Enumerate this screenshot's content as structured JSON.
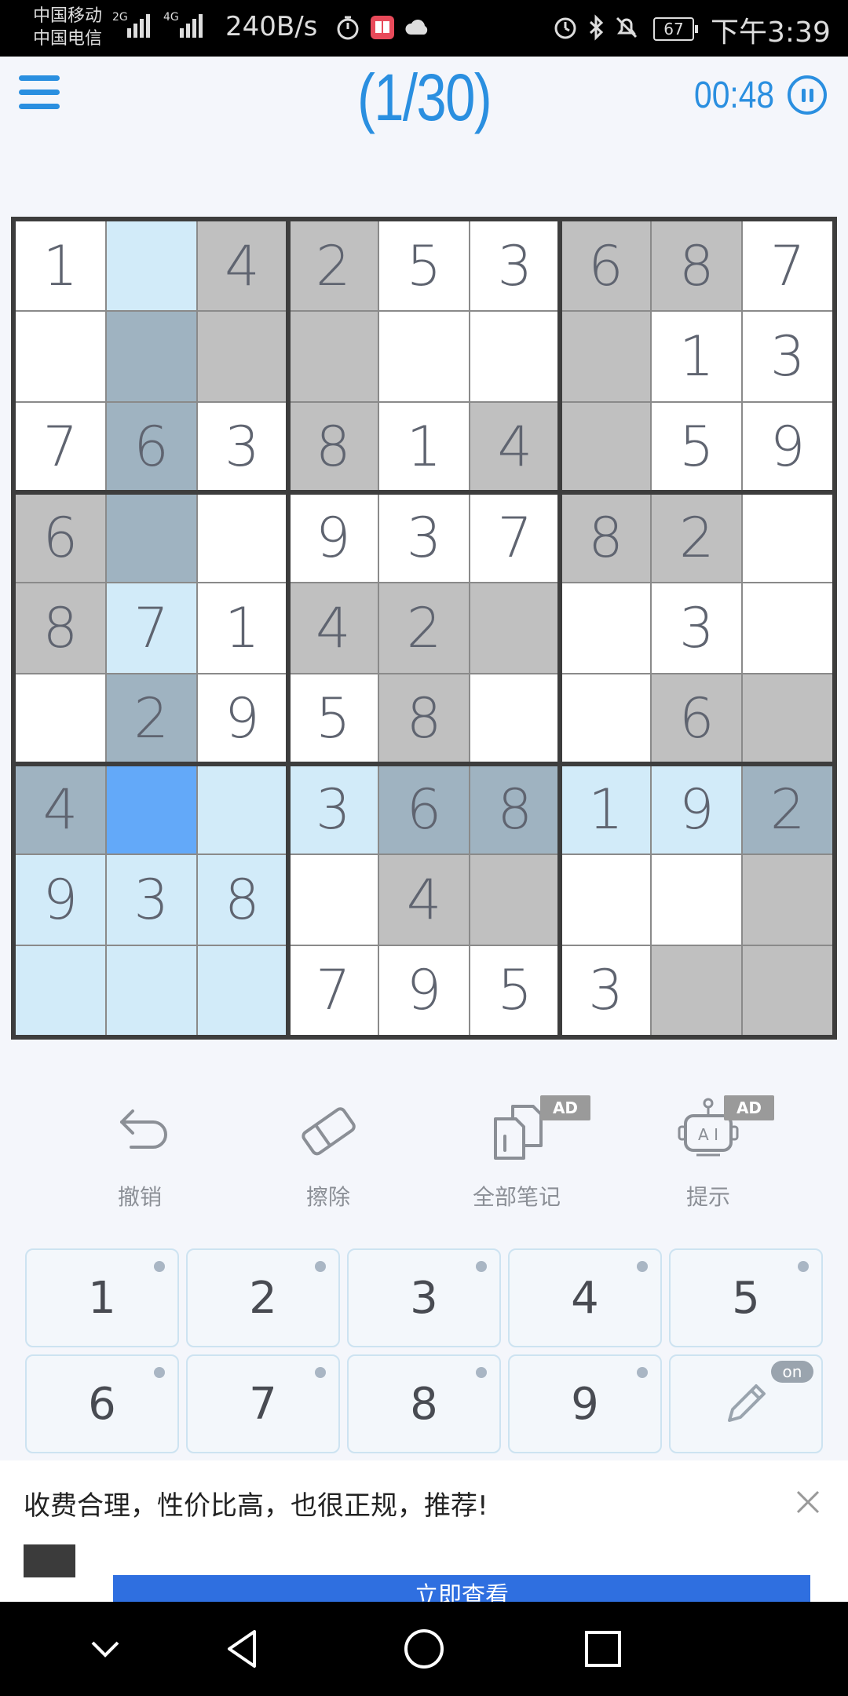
{
  "status_bar": {
    "carrier_1": "中国移动",
    "carrier_2": "中国电信",
    "net_1": "2G",
    "net_2": "4G",
    "speed": "240B/s",
    "battery": "67",
    "time": "下午3:39"
  },
  "header": {
    "level": "(1/30)",
    "timer": "00:48"
  },
  "board": {
    "rows": [
      [
        "1",
        "",
        "4",
        "2",
        "5",
        "3",
        "6",
        "8",
        "7"
      ],
      [
        "",
        "",
        "",
        "",
        "",
        "",
        "",
        "1",
        "3"
      ],
      [
        "7",
        "6",
        "3",
        "8",
        "1",
        "4",
        "",
        "5",
        "9"
      ],
      [
        "6",
        "",
        "",
        "9",
        "3",
        "7",
        "8",
        "2",
        ""
      ],
      [
        "8",
        "7",
        "1",
        "4",
        "2",
        "",
        "",
        "3",
        ""
      ],
      [
        "",
        "2",
        "9",
        "5",
        "8",
        "",
        "",
        "6",
        ""
      ],
      [
        "4",
        "",
        "",
        "3",
        "6",
        "8",
        "1",
        "9",
        "2"
      ],
      [
        "9",
        "3",
        "8",
        "",
        "4",
        "",
        "",
        "",
        ""
      ],
      [
        "",
        "",
        "",
        "7",
        "9",
        "5",
        "3",
        "",
        ""
      ]
    ],
    "shading": [
      [
        "w",
        "l",
        "g",
        "g",
        "w",
        "w",
        "g",
        "g",
        "w"
      ],
      [
        "w",
        "b",
        "g",
        "g",
        "w",
        "w",
        "g",
        "w",
        "w"
      ],
      [
        "w",
        "b",
        "w",
        "g",
        "w",
        "g",
        "g",
        "w",
        "w"
      ],
      [
        "g",
        "b",
        "w",
        "w",
        "w",
        "w",
        "g",
        "g",
        "w"
      ],
      [
        "g",
        "l",
        "w",
        "g",
        "g",
        "g",
        "w",
        "w",
        "w"
      ],
      [
        "w",
        "b",
        "w",
        "w",
        "g",
        "w",
        "w",
        "g",
        "g"
      ],
      [
        "b",
        "s",
        "l",
        "l",
        "b",
        "b",
        "l",
        "l",
        "b"
      ],
      [
        "l",
        "l",
        "l",
        "w",
        "g",
        "g",
        "w",
        "w",
        "g"
      ],
      [
        "l",
        "l",
        "l",
        "w",
        "w",
        "w",
        "w",
        "g",
        "g"
      ]
    ],
    "colors": {
      "white": "#ffffff",
      "gray": "#c0c0c0",
      "light_blue": "#d2ebf9",
      "blue_gray": "#9fb3c1",
      "selected": "#63a9f9"
    }
  },
  "tools": [
    {
      "label": "撤销",
      "icon": "undo-icon",
      "ad": ""
    },
    {
      "label": "擦除",
      "icon": "eraser-icon",
      "ad": ""
    },
    {
      "label": "全部笔记",
      "icon": "notes-icon",
      "ad": "AD"
    },
    {
      "label": "提示",
      "icon": "robot-hint-icon",
      "ad": "AD"
    }
  ],
  "keypad": {
    "keys": [
      "1",
      "2",
      "3",
      "4",
      "5",
      "6",
      "7",
      "8",
      "9"
    ],
    "pencil_state": "on"
  },
  "ad": {
    "text": "收费合理，性价比高，也很正规，推荐!",
    "cta": "立即查看"
  }
}
